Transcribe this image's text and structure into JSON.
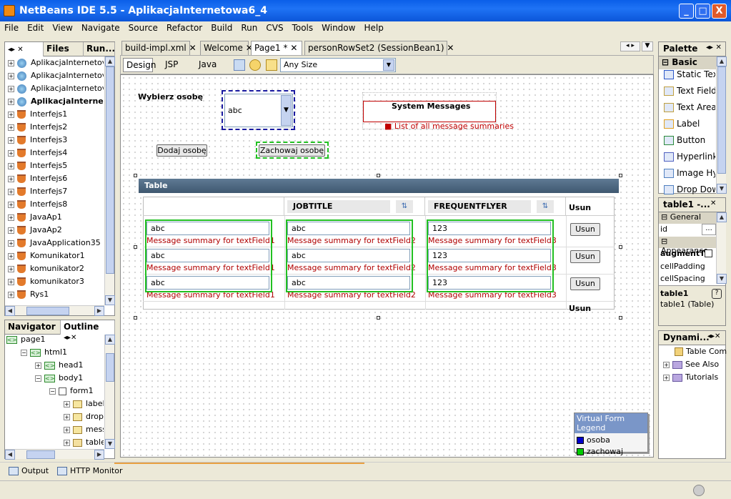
{
  "window": {
    "title": "NetBeans IDE 5.5 - AplikacjaInternetowa6_4",
    "minimize": "_",
    "maximize": "□",
    "close": "X"
  },
  "menu": [
    "File",
    "Edit",
    "View",
    "Navigate",
    "Source",
    "Refactor",
    "Build",
    "Run",
    "CVS",
    "Tools",
    "Window",
    "Help"
  ],
  "left_top": {
    "tabs": [
      "Files",
      "Run..."
    ],
    "items": [
      {
        "label": "AplikacjaInternetov",
        "icon": "globe"
      },
      {
        "label": "AplikacjaInternetov",
        "icon": "globe"
      },
      {
        "label": "AplikacjaInternetov",
        "icon": "globe"
      },
      {
        "label": "AplikacjaInterne",
        "icon": "globe",
        "bold": true
      },
      {
        "label": "Interfejs1",
        "icon": "cup"
      },
      {
        "label": "Interfejs2",
        "icon": "cup"
      },
      {
        "label": "Interfejs3",
        "icon": "cup"
      },
      {
        "label": "Interfejs4",
        "icon": "cup"
      },
      {
        "label": "Interfejs5",
        "icon": "cup"
      },
      {
        "label": "Interfejs6",
        "icon": "cup"
      },
      {
        "label": "Interfejs7",
        "icon": "cup"
      },
      {
        "label": "Interfejs8",
        "icon": "cup"
      },
      {
        "label": "JavaAp1",
        "icon": "cup"
      },
      {
        "label": "JavaAp2",
        "icon": "cup"
      },
      {
        "label": "JavaApplication35",
        "icon": "cup"
      },
      {
        "label": "Komunikator1",
        "icon": "cup"
      },
      {
        "label": "komunikator2",
        "icon": "cup"
      },
      {
        "label": "komunikator3",
        "icon": "cup"
      },
      {
        "label": "Rys1",
        "icon": "cup"
      }
    ]
  },
  "left_bottom": {
    "tabs": [
      "Navigator",
      "Outline"
    ],
    "items": [
      {
        "label": "page1",
        "indent": 0,
        "icon": "tag"
      },
      {
        "label": "html1",
        "indent": 1,
        "icon": "tag",
        "exp": "-"
      },
      {
        "label": "head1",
        "indent": 2,
        "icon": "tag",
        "exp": "+"
      },
      {
        "label": "body1",
        "indent": 2,
        "icon": "tag",
        "exp": "-"
      },
      {
        "label": "form1",
        "indent": 3,
        "icon": "form",
        "exp": "-"
      },
      {
        "label": "label1:'",
        "indent": 4,
        "icon": "label",
        "exp": "+"
      },
      {
        "label": "dropDc",
        "indent": 4,
        "icon": "drop",
        "exp": "+"
      },
      {
        "label": "messag",
        "indent": 4,
        "icon": "msg",
        "exp": "+"
      },
      {
        "label": "table1",
        "indent": 4,
        "icon": "table",
        "exp": "+"
      }
    ]
  },
  "editor_tabs": [
    "build-impl.xml",
    "Welcome",
    "Page1 *",
    "personRowSet2 (SessionBean1)"
  ],
  "editor_toolbar": {
    "views": [
      "Design",
      "JSP",
      "Java"
    ],
    "size_select": "Any Size"
  },
  "form": {
    "label": "Wybierz osobę",
    "dropdown_value": "abc",
    "add_button": "Dodaj osobę",
    "save_button": "Zachowaj osobę",
    "system_messages_title": "System Messages",
    "system_messages_item": "List of all message summaries"
  },
  "table": {
    "title": "Table",
    "columns": [
      "",
      "JOBTITLE",
      "FREQUENTFLYER",
      "Usun"
    ],
    "rows": [
      {
        "c1": "abc",
        "c2": "abc",
        "c3": "123",
        "btn": "Usun"
      },
      {
        "c1": "abc",
        "c2": "abc",
        "c3": "123",
        "btn": "Usun"
      },
      {
        "c1": "abc",
        "c2": "abc",
        "c3": "123",
        "btn": "Usun"
      }
    ],
    "err1": "Message summary for textField1",
    "err2": "Message summary for textField2",
    "err3": "Message summary for textField3",
    "footer": "Usun"
  },
  "legend": {
    "title": "Virtual Form Legend",
    "items": [
      {
        "label": "osoba",
        "color": "#0000cc"
      },
      {
        "label": "zachowaj",
        "color": "#00cc00"
      }
    ]
  },
  "palette": {
    "title": "Palette",
    "section": "Basic",
    "items": [
      "Static Text",
      "Text Field",
      "Text Area",
      "Label",
      "Button",
      "Hyperlink",
      "Image Hype",
      "Drop Down"
    ]
  },
  "properties": {
    "title": "table1 -...",
    "general": "General",
    "id_label": "id",
    "id_value": "...",
    "appearance": "Appearance",
    "props": [
      "augmentT",
      "cellPadding",
      "cellSpacing"
    ],
    "desc_title": "table1",
    "desc_text": "table1 (Table)"
  },
  "dynamic": {
    "title": "Dynami...",
    "items": [
      "Table Com",
      "See Also",
      "Tutorials"
    ]
  },
  "bottom": {
    "output": "Output",
    "http": "HTTP Monitor"
  }
}
